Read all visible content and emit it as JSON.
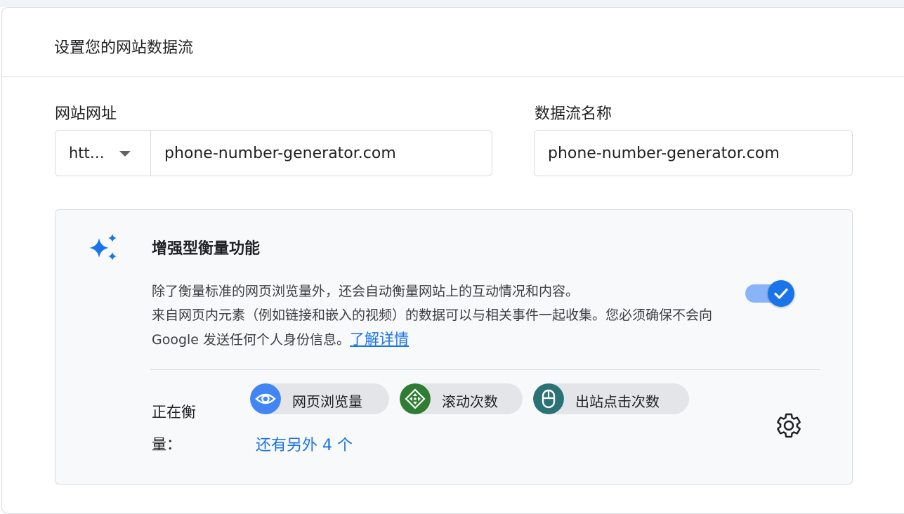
{
  "card": {
    "title": "设置您的网站数据流"
  },
  "website_url": {
    "label": "网站网址",
    "protocol": "htt…",
    "value": "phone-number-generator.com"
  },
  "stream_name": {
    "label": "数据流名称",
    "value": "phone-number-generator.com"
  },
  "enhanced_measurement": {
    "title": "增强型衡量功能",
    "description_line1": "除了衡量标准的网页浏览量外，还会自动衡量网站上的互动情况和内容。",
    "description_line2": "来自网页内元素（例如链接和嵌入的视频）的数据可以与相关事件一起收集。您必须确保不会向 Google 发送任何个人身份信息。",
    "learn_more": "了解详情",
    "enabled": true,
    "measuring_label": "正在衡量：",
    "chips": [
      {
        "label": "网页浏览量",
        "icon": "eye-icon",
        "color": "#4285f4"
      },
      {
        "label": "滚动次数",
        "icon": "scroll-icon",
        "color": "#2e7d32"
      },
      {
        "label": "出站点击次数",
        "icon": "mouse-icon",
        "color": "#2a7276"
      }
    ],
    "more_link": "还有另外 4 个"
  },
  "colors": {
    "accent": "#1a73e8",
    "panel_bg": "#f8f9fa"
  }
}
